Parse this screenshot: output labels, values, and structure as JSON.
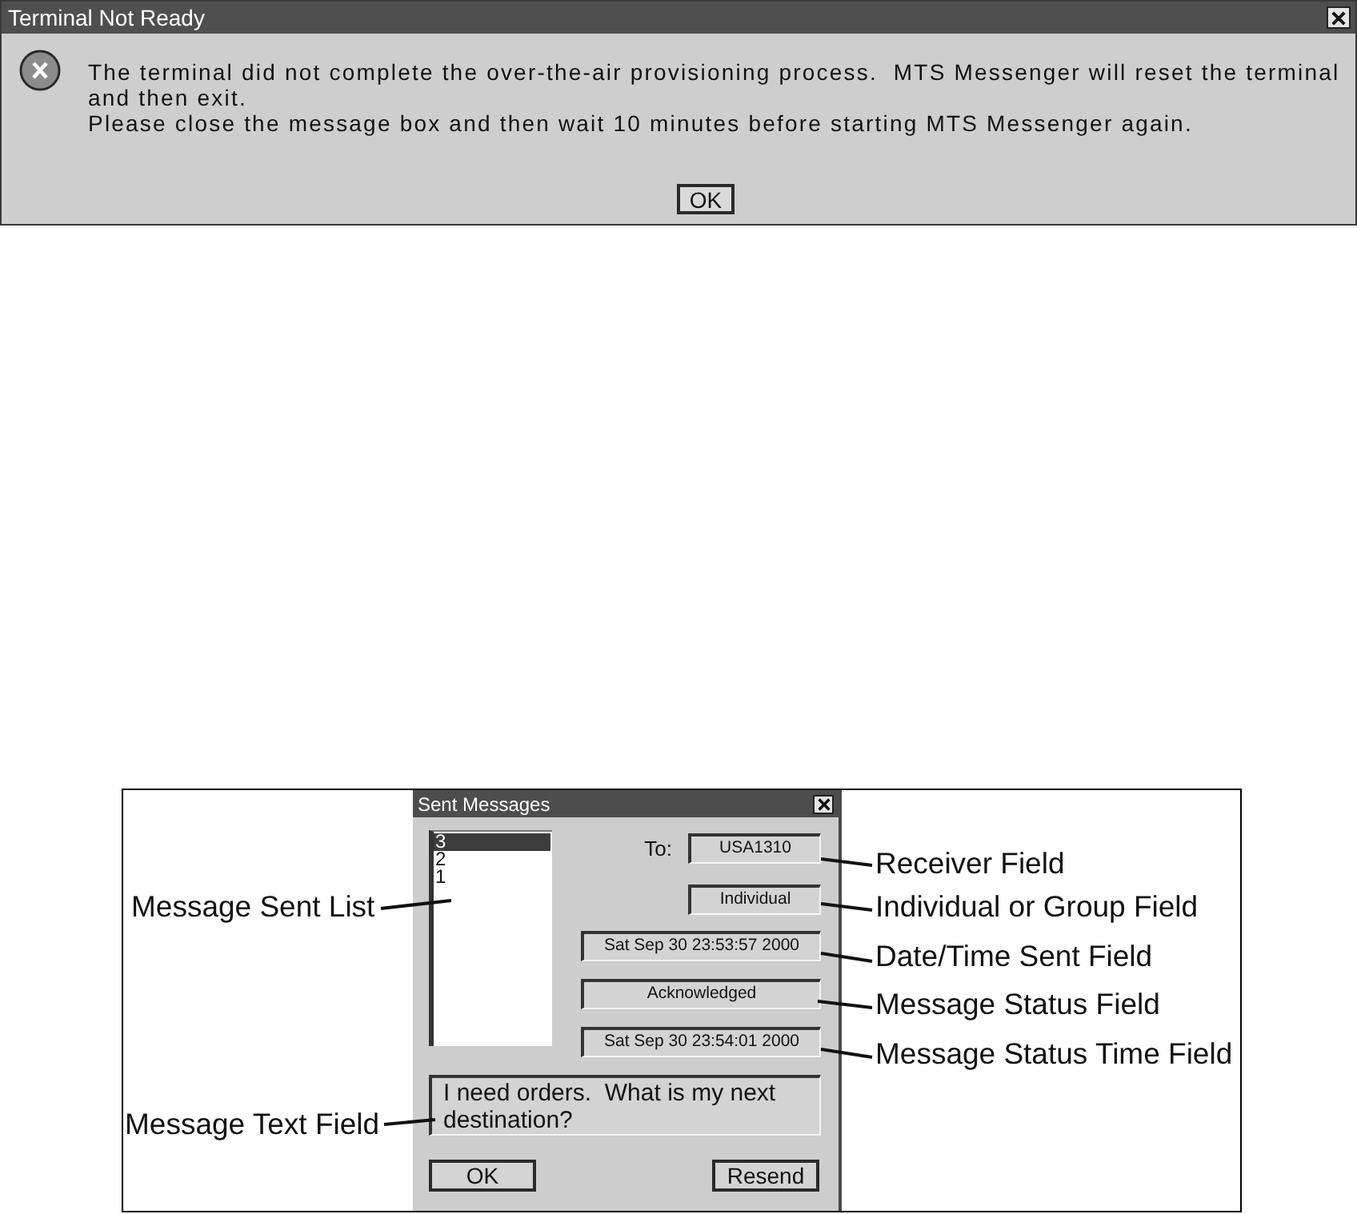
{
  "alert_dialog": {
    "title": "Terminal Not Ready",
    "paragraphs": [
      "The terminal did not complete the over-the-air provisioning process.  MTS Messenger will reset the terminal and then exit.",
      "Please close the message box and then wait 10 minutes before starting MTS Messenger again."
    ],
    "buttons": [
      "OK"
    ]
  },
  "figure": {
    "dialog": {
      "title": "Sent Messages",
      "message_list": {
        "items": [
          {
            "label": "3",
            "selected": true
          },
          {
            "label": "2",
            "selected": false
          },
          {
            "label": "1",
            "selected": false
          }
        ],
        "callout": "Message Sent List"
      },
      "to_label": "To:",
      "receiver": {
        "value": "USA1310",
        "callout": "Receiver Field"
      },
      "recipient_type": {
        "value": "Individual",
        "callout": "Individual or Group Field"
      },
      "date_time_sent": {
        "value": "Sat Sep 30 23:53:57 2000",
        "callout": "Date/Time Sent Field"
      },
      "message_status": {
        "value": "Acknowledged",
        "callout": "Message Status Field"
      },
      "status_time": {
        "value": "Sat Sep 30 23:54:01 2000",
        "callout": "Message Status Time Field"
      },
      "message_text": {
        "value": "I need orders.  What is my next destination?",
        "callout": "Message Text Field"
      },
      "buttons": [
        "OK",
        "Resend"
      ]
    }
  }
}
